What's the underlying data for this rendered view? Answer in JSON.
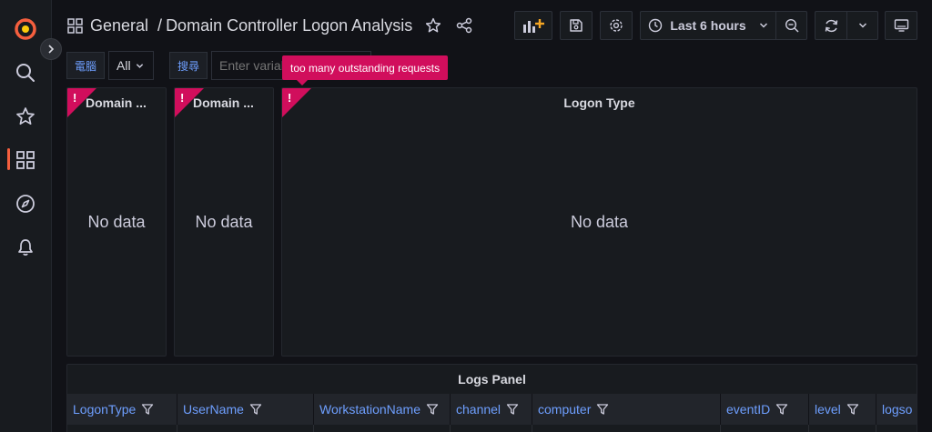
{
  "colors": {
    "background": "#111217",
    "panel": "#181b1f",
    "error": "#d10e5c",
    "link": "#6e9fff",
    "brand": "#f55f3e"
  },
  "sidebar": {
    "icons": [
      "grafana-logo-icon",
      "search-icon",
      "starred-icon",
      "dashboards-icon",
      "explore-icon",
      "alerting-icon"
    ],
    "active": "dashboards-icon"
  },
  "breadcrumb": {
    "folder": "General",
    "separator": "/",
    "title": "Domain Controller Logon Analysis"
  },
  "toolbar": {
    "time_range": "Last 6 hours",
    "buttons": [
      "add-panel-icon",
      "save-icon",
      "settings-icon",
      "clock-icon",
      "zoom-out-icon",
      "refresh-icon",
      "tv-icon"
    ]
  },
  "variables": {
    "computer_label": "電腦",
    "computer_value": "All",
    "search_label": "搜尋",
    "search_placeholder": "Enter variable value"
  },
  "tooltip": "too many outstanding requests",
  "panels": {
    "panel1": {
      "title": "Domain ...",
      "empty": "No data",
      "error": "!"
    },
    "panel2": {
      "title": "Domain ...",
      "empty": "No data",
      "error": "!"
    },
    "logon_type": {
      "title": "Logon Type",
      "empty": "No data",
      "error": "!"
    }
  },
  "logs_panel": {
    "title": "Logs Panel",
    "columns": [
      "LogonType",
      "UserName",
      "WorkstationName",
      "channel",
      "computer",
      "eventID",
      "level",
      "logso"
    ]
  }
}
